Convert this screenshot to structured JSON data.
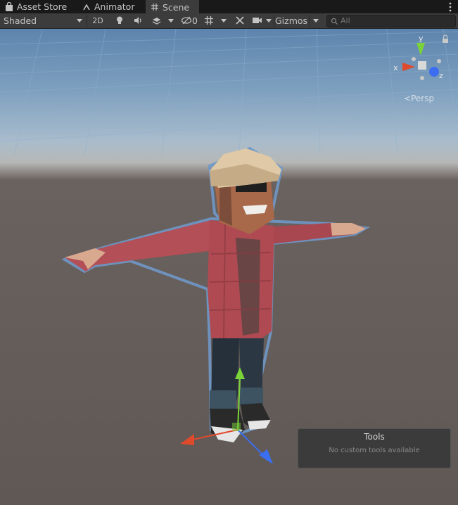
{
  "tabs": [
    {
      "label": "Asset Store",
      "icon": "shopping-bag-icon",
      "active": false
    },
    {
      "label": "Animator",
      "icon": "animator-icon",
      "active": false
    },
    {
      "label": "Scene",
      "icon": "grid-hash-icon",
      "active": true
    }
  ],
  "toolbar": {
    "draw_mode": "Shaded",
    "mode_2d": "2D",
    "hidden_count": "0",
    "gizmos": "Gizmos",
    "search_placeholder": "All"
  },
  "scene": {
    "projection_label": "Persp",
    "axes": {
      "x": "x",
      "y": "y",
      "z": "z"
    }
  },
  "tools_panel": {
    "title": "Tools",
    "message": "No custom tools available"
  },
  "colors": {
    "x_axis": "#e04a2c",
    "y_axis": "#7bd33a",
    "z_axis": "#3b6ef0",
    "selection_outline": "#6f98c8"
  }
}
